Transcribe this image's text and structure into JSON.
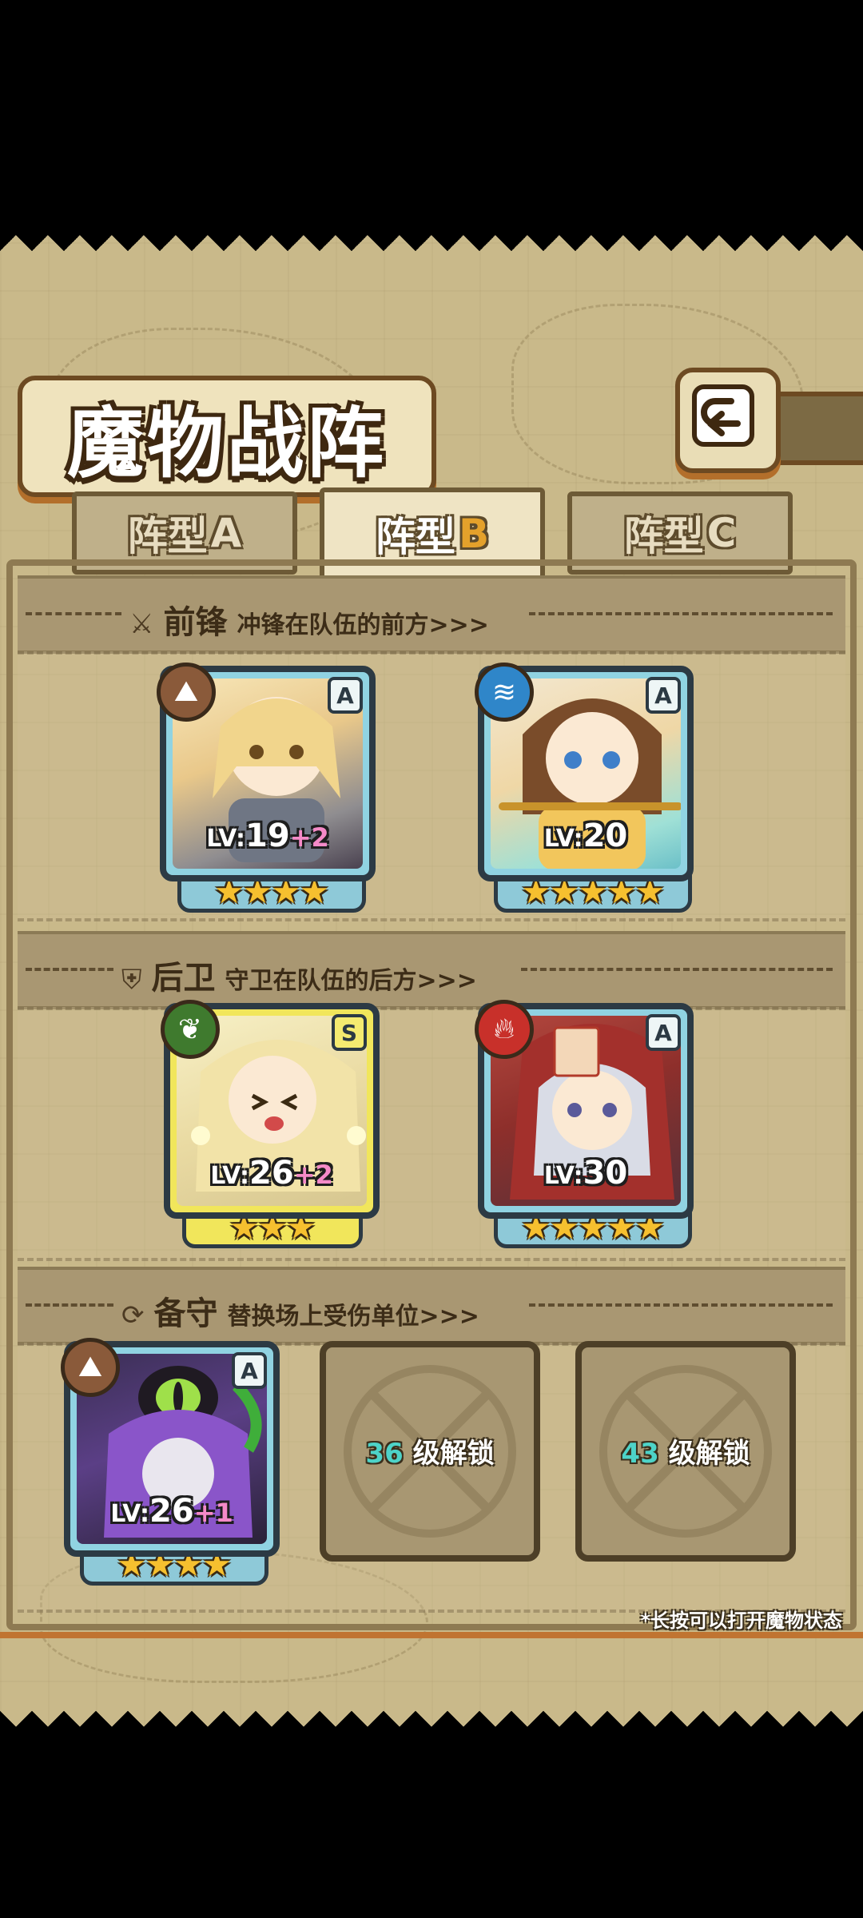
{
  "title": "魔物战阵",
  "tabs": [
    {
      "label": "阵型",
      "letter": "A",
      "active": false
    },
    {
      "label": "阵型",
      "letter": "B",
      "active": true
    },
    {
      "label": "阵型",
      "letter": "C",
      "active": false
    }
  ],
  "sections": {
    "front": {
      "icon": "sword-icon",
      "title": "前锋",
      "subtitle": "冲锋在队伍的前方>>>"
    },
    "back": {
      "icon": "shield-icon",
      "title": "后卫",
      "subtitle": "守卫在队伍的后方>>>"
    },
    "reserve": {
      "icon": "swap-icon",
      "title": "备守",
      "subtitle": "替换场上受伤单位>>>"
    }
  },
  "cards": {
    "front1": {
      "rank": "A",
      "element": "earth",
      "level_label": "LV:",
      "level": "19",
      "bonus": "+2",
      "stars": 4
    },
    "front2": {
      "rank": "A",
      "element": "water",
      "level_label": "LV:",
      "level": "20",
      "bonus": "",
      "stars": 5
    },
    "back1": {
      "rank": "S",
      "element": "nature",
      "level_label": "LV:",
      "level": "26",
      "bonus": "+2",
      "stars": 3
    },
    "back2": {
      "rank": "A",
      "element": "fire",
      "level_label": "LV:",
      "level": "30",
      "bonus": "",
      "stars": 5
    },
    "reserve1": {
      "rank": "A",
      "element": "earth",
      "level_label": "LV:",
      "level": "26",
      "bonus": "+1",
      "stars": 4
    }
  },
  "locked_slots": [
    {
      "level": "36",
      "text": "级解锁"
    },
    {
      "level": "43",
      "text": "级解锁"
    }
  ],
  "footnote": "*长按可以打开魔物状态",
  "colors": {
    "earth": "#8a5a3a",
    "water": "#2f86c9",
    "nature": "#3f7a2e",
    "fire": "#c8302a",
    "star": "#f6c02f",
    "bonus": "#f58ac8",
    "unlock_level": "#4dd3c8"
  }
}
